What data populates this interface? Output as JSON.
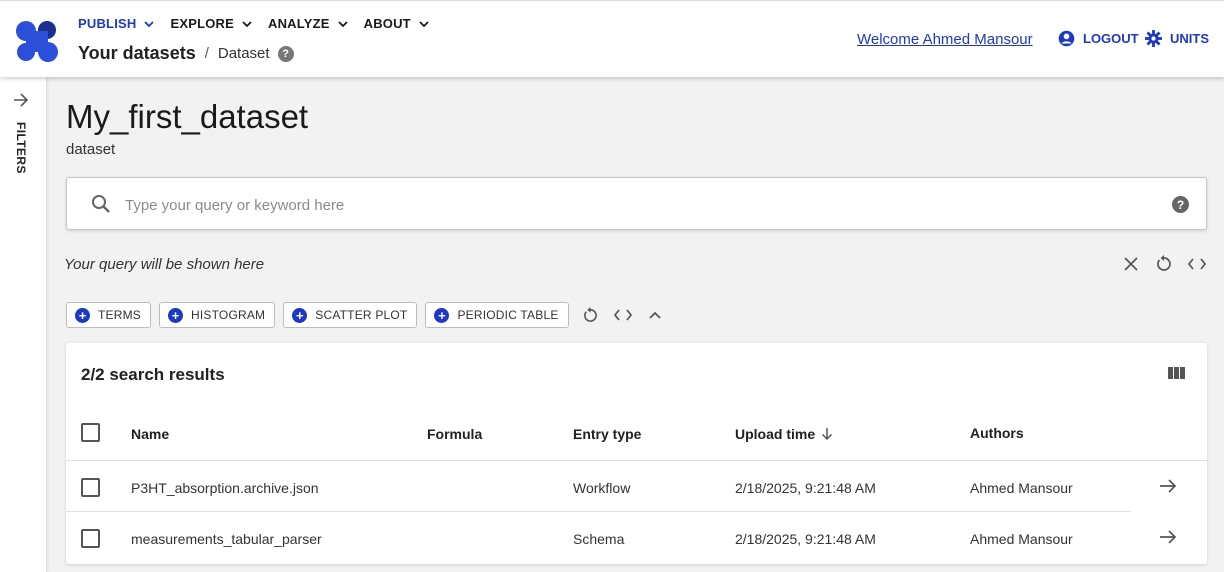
{
  "nav": {
    "items": [
      {
        "label": "PUBLISH",
        "active": true
      },
      {
        "label": "EXPLORE",
        "active": false
      },
      {
        "label": "ANALYZE",
        "active": false
      },
      {
        "label": "ABOUT",
        "active": false
      }
    ]
  },
  "breadcrumb": {
    "root": "Your datasets",
    "separator": "/",
    "current": "Dataset",
    "help": "?"
  },
  "header": {
    "welcome": "Welcome Ahmed Mansour",
    "logout": "LOGOUT",
    "units": "UNITS"
  },
  "sidebar": {
    "filters_label": "FILTERS"
  },
  "page": {
    "title": "My_first_dataset",
    "subtitle": "dataset"
  },
  "search": {
    "placeholder": "Type your query or keyword here",
    "value": "",
    "help": "?"
  },
  "query": {
    "text": "Your query will be shown here"
  },
  "widgets": {
    "chips": [
      "TERMS",
      "HISTOGRAM",
      "SCATTER PLOT",
      "PERIODIC TABLE"
    ]
  },
  "results": {
    "count": "2/2 search results",
    "columns": {
      "name": "Name",
      "formula": "Formula",
      "entry_type": "Entry type",
      "upload_time": "Upload time",
      "authors": "Authors"
    },
    "sort": {
      "column": "upload_time",
      "direction": "descending"
    },
    "rows": [
      {
        "name": "P3HT_absorption.archive.json",
        "formula": "",
        "entry_type": "Workflow",
        "upload_time": "2/18/2025, 9:21:48 AM",
        "authors": "Ahmed Mansour"
      },
      {
        "name": "measurements_tabular_parser",
        "formula": "",
        "entry_type": "Schema",
        "upload_time": "2/18/2025, 9:21:48 AM",
        "authors": "Ahmed Mansour"
      }
    ]
  },
  "colors": {
    "accent": "#1d39c4",
    "background": "#f2f2f2",
    "surface": "#ffffff"
  },
  "icons": {
    "logo": "app-logo",
    "search": "search-icon",
    "help": "help-circle-icon",
    "account": "account-circle-icon",
    "settings": "gear-icon",
    "close": "close-icon",
    "reset": "refresh-icon",
    "code": "code-icon",
    "collapse": "chevron-up-icon",
    "columns": "view-column-icon",
    "row_link": "arrow-right-icon"
  }
}
